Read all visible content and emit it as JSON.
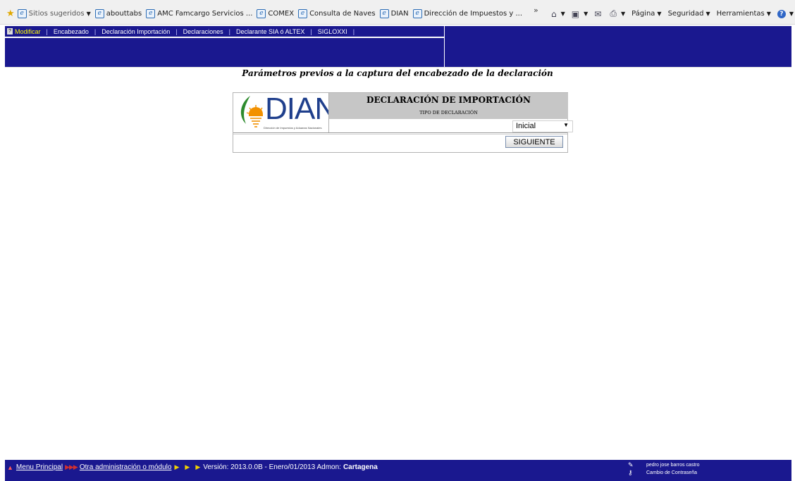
{
  "browser": {
    "favorites": [
      {
        "label": "Sitios sugeridos",
        "dropdown": true,
        "muted": true
      },
      {
        "label": "abouttabs"
      },
      {
        "label": "AMC Famcargo Servicios ..."
      },
      {
        "label": "COMEX"
      },
      {
        "label": "Consulta de Naves"
      },
      {
        "label": "DIAN"
      },
      {
        "label": "Dirección de Impuestos y ..."
      }
    ],
    "overflow": "»",
    "tools": {
      "pagina": "Página",
      "seguridad": "Seguridad",
      "herramientas": "Herramientas"
    }
  },
  "menu": {
    "help_glyph": "?",
    "items": [
      "Modificar",
      "Encabezado",
      "Declaración Importación",
      "Declaraciones",
      "Declarante SIA ó ALTEX",
      "SIGLOXXI"
    ],
    "separator": "|"
  },
  "page": {
    "title": "Parámetros previos a la captura del encabezado de la declaración"
  },
  "form": {
    "logo_text": "DIAN",
    "logo_caption": "Dirección de Impuestos y Aduanas Nacionales",
    "heading": "DECLARACIÓN DE IMPORTACIÓN",
    "subheading": "TIPO DE DECLARACIÓN",
    "tipo_value": "Inicial",
    "next_label": "SIGUIENTE"
  },
  "footer": {
    "menu_principal": "Menu Principal",
    "otra": "Otra administración o módulo",
    "version_text": "Versión: 2013.0.0B - Enero/01/2013 Admon:",
    "admon": "Cartagena",
    "user": "pedro jose barros castro",
    "change_password": "Cambio de Contraseña"
  },
  "colors": {
    "nav_blue": "#1a188f",
    "active_menu": "#ffff00",
    "dian_blue": "#1f3f8c",
    "dian_green": "#2e8b2e",
    "dian_orange": "#f29100"
  }
}
